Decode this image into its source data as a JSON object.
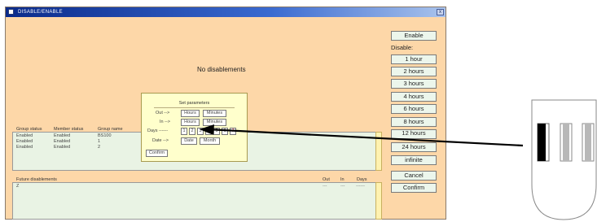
{
  "window": {
    "title": "DISABLE/ENABLE",
    "close_label": "x",
    "status_message": "No disablements"
  },
  "group_table": {
    "headers": [
      "Group status",
      "Member status",
      "Group name"
    ],
    "rows": [
      [
        "Enabled",
        "Enabled",
        "BS100"
      ],
      [
        "Enabled",
        "Enabled",
        "1"
      ],
      [
        "Enabled",
        "Enabled",
        "2"
      ]
    ]
  },
  "future_table": {
    "title": "Future disablements",
    "headers": [
      "Out",
      "In",
      "Days"
    ],
    "row_index": "Z",
    "values": [
      "---",
      "---",
      "------"
    ]
  },
  "side_panel": {
    "enable_label": "Enable",
    "disable_label": "Disable:",
    "durations": [
      "1 hour",
      "2 hours",
      "3 hours",
      "4 hours",
      "6 hours",
      "8 hours",
      "12 hours",
      "24 hours",
      "infinite"
    ],
    "cancel_label": "Cancel",
    "confirm_label": "Confirm"
  },
  "dialog": {
    "title": "Set parameters",
    "out_label": "Out -->",
    "in_label": "In -->",
    "days_label": "Days ------",
    "date_label": "Date -->",
    "hours_label": "Hours",
    "minutes_label": "Minutes",
    "days": [
      "1",
      "2",
      "3",
      "4",
      "5",
      "6",
      "7"
    ],
    "date_button": "Date",
    "month_button": "Month",
    "confirm_label": "Confirm"
  },
  "colors": {
    "window_bg": "#fdd7a8",
    "list_bg": "#e9f3e4",
    "dialog_bg": "#ffffcc",
    "button_bg": "#ecf6ec",
    "day7_text": "#cc3333"
  }
}
